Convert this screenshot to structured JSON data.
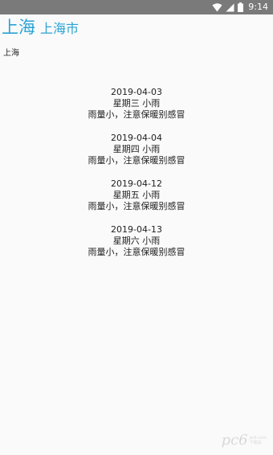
{
  "status_bar": {
    "time": "9:14",
    "icons": [
      "wifi-icon",
      "signal-icon",
      "battery-icon"
    ],
    "background": "#7a7a7a"
  },
  "header": {
    "title": "上海",
    "subtitle": "上海市",
    "accent_color": "#2aa3d4"
  },
  "city_label": "上海",
  "forecasts": [
    {
      "date": "2019-04-03",
      "weekday": "星期三",
      "weather": "小雨",
      "tip": "雨量小，注意保暖别感冒"
    },
    {
      "date": "2019-04-04",
      "weekday": "星期四",
      "weather": "小雨",
      "tip": "雨量小，注意保暖别感冒"
    },
    {
      "date": "2019-04-12",
      "weekday": "星期五",
      "weather": "小雨",
      "tip": "雨量小，注意保暖别感冒"
    },
    {
      "date": "2019-04-13",
      "weekday": "星期六",
      "weather": "小雨",
      "tip": "雨量小，注意保暖别感冒"
    }
  ],
  "watermark": {
    "text": "pc6",
    "sub1": "pc6.com",
    "sub2": "下载站"
  }
}
